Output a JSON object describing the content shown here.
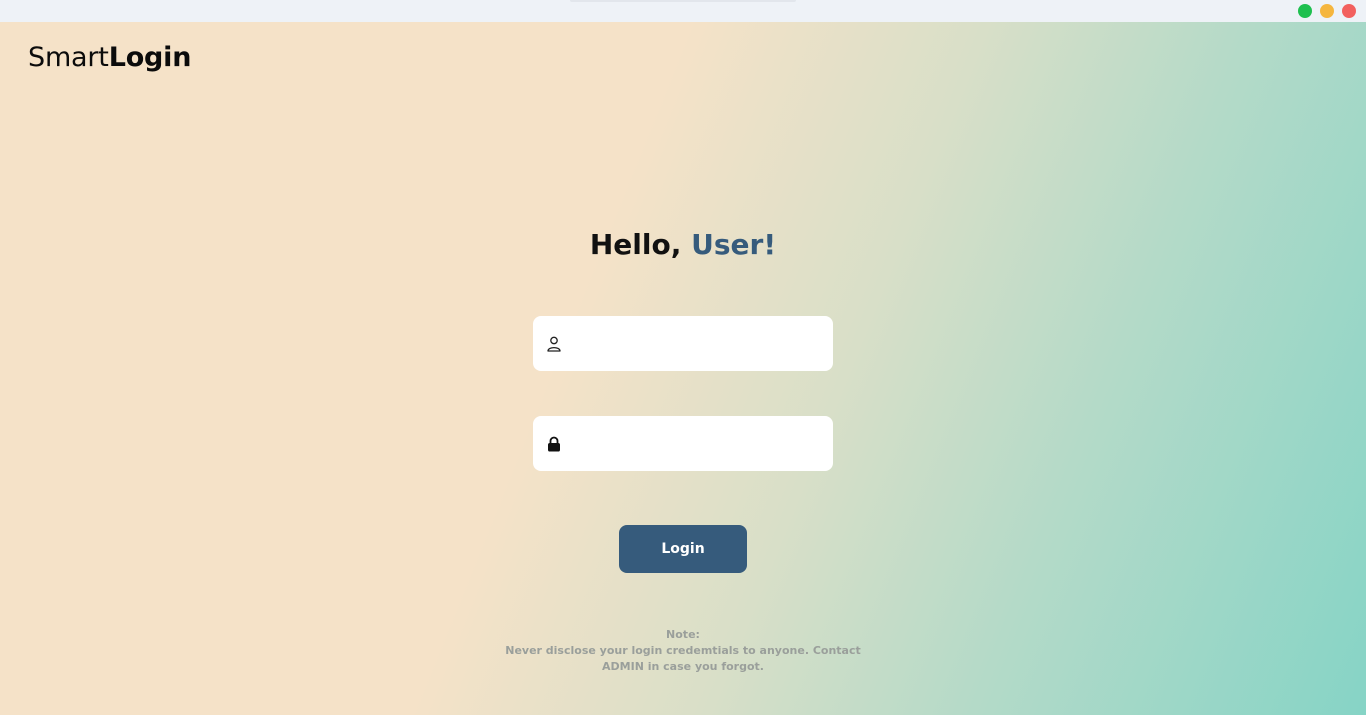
{
  "window": {
    "controls": [
      "maximize",
      "minimize",
      "close"
    ],
    "colors": {
      "green": "#1ec04f",
      "yellow": "#f5b63e",
      "red": "#f2605e"
    }
  },
  "brand": {
    "light": "Smart",
    "bold": "Login"
  },
  "greeting": {
    "prefix": "Hello, ",
    "accent": "User!"
  },
  "form": {
    "username": {
      "icon": "user-icon",
      "value": "",
      "placeholder": ""
    },
    "password": {
      "icon": "lock-icon",
      "value": "",
      "placeholder": ""
    },
    "submit_label": "Login"
  },
  "note": {
    "title": "Note:",
    "body": "Never disclose your login credemtials to anyone. Contact ADMIN in case you forgot."
  },
  "colors": {
    "accent": "#365b7c",
    "button_text": "#ffffff",
    "note_text": "#9a9f9b"
  }
}
